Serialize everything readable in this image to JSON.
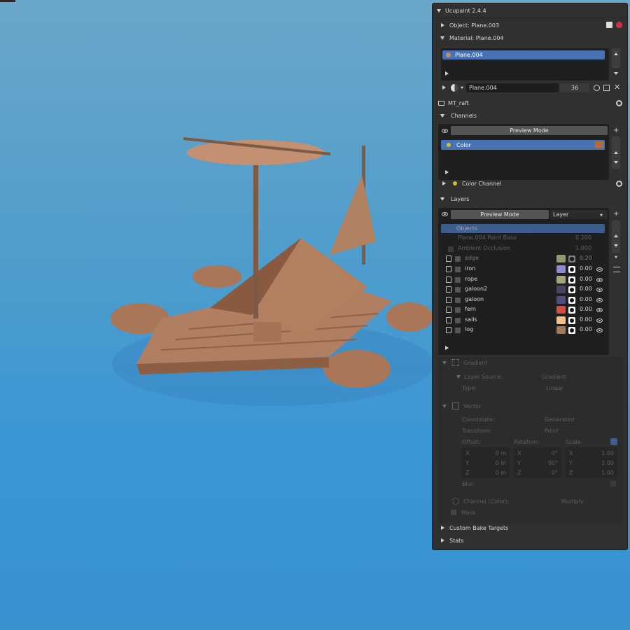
{
  "panel": {
    "title": "Ucupaint 2.4.4",
    "object_label": "Object: Plane.003",
    "material_label": "Material: Plane.004",
    "material_slot": "Plane.004",
    "material_field": "Plane.004",
    "material_users": "36",
    "node_group": "MT_raft",
    "channels_header": "Channels",
    "channels_preview_mode": "Preview Mode",
    "channel_item": "Color",
    "color_channel_label": "Color Channel",
    "layers_header": "Layers",
    "layers_preview_mode": "Preview Mode",
    "layers_dropdown": "Layer",
    "layers": [
      {
        "name": "Objects",
        "value": "",
        "disabled": true,
        "selected": true
      },
      {
        "name": "Plane.004 Paint Base",
        "value": "0.200",
        "disabled": true
      },
      {
        "name": "Ambient Occlusion",
        "value": "1.000",
        "disabled": true
      },
      {
        "name": "edge",
        "value": "0.20",
        "color": "#8f9a72",
        "disabled": true
      },
      {
        "name": "iron",
        "value": "0.00",
        "color": "#8e88d6"
      },
      {
        "name": "rope",
        "value": "0.00",
        "color": "#a6a47a"
      },
      {
        "name": "galoon2",
        "value": "0.00",
        "color": "#4b4460"
      },
      {
        "name": "galoon",
        "value": "0.00",
        "color": "#4f4e86"
      },
      {
        "name": "fern",
        "value": "0.00",
        "color": "#d94a43"
      },
      {
        "name": "sails",
        "value": "0.00",
        "color": "#f1c28c"
      },
      {
        "name": "log",
        "value": "0.00",
        "color": "#a3795c"
      }
    ],
    "gradient": {
      "header": "Gradient",
      "layer_source_label": "Layer Source:",
      "layer_source_value": "Gradient",
      "type_label": "Type:",
      "type_value": "Linear"
    },
    "vector": {
      "header": "Vector",
      "coordinate_label": "Coordinate:",
      "coordinate_value": "Generated",
      "transform_label": "Transform:",
      "transform_value": "Point",
      "offset_label": "Offset:",
      "rotation_label": "Rotation:",
      "scale_label": "Scale:",
      "offset": [
        {
          "axis": "X",
          "value": "0 m"
        },
        {
          "axis": "Y",
          "value": "0 m"
        },
        {
          "axis": "Z",
          "value": "0 m"
        }
      ],
      "rotation": [
        {
          "axis": "X",
          "value": "0°"
        },
        {
          "axis": "Y",
          "value": "90°"
        },
        {
          "axis": "Z",
          "value": "0°"
        }
      ],
      "scale": [
        {
          "axis": "X",
          "value": "1.00"
        },
        {
          "axis": "Y",
          "value": "1.00"
        },
        {
          "axis": "Z",
          "value": "1.00"
        }
      ],
      "blur_label": "Blur:"
    },
    "channel_color_label": "Channel (Color):",
    "channel_color_blend": "Multiply",
    "mask_label": "Mask",
    "custom_bake_targets": "Custom Bake Targets",
    "stats": "Stats"
  },
  "colors": {
    "panel_bg": "#303030",
    "selection": "#4772b3",
    "water": "#3a92cf",
    "wood": "#b07e60"
  }
}
